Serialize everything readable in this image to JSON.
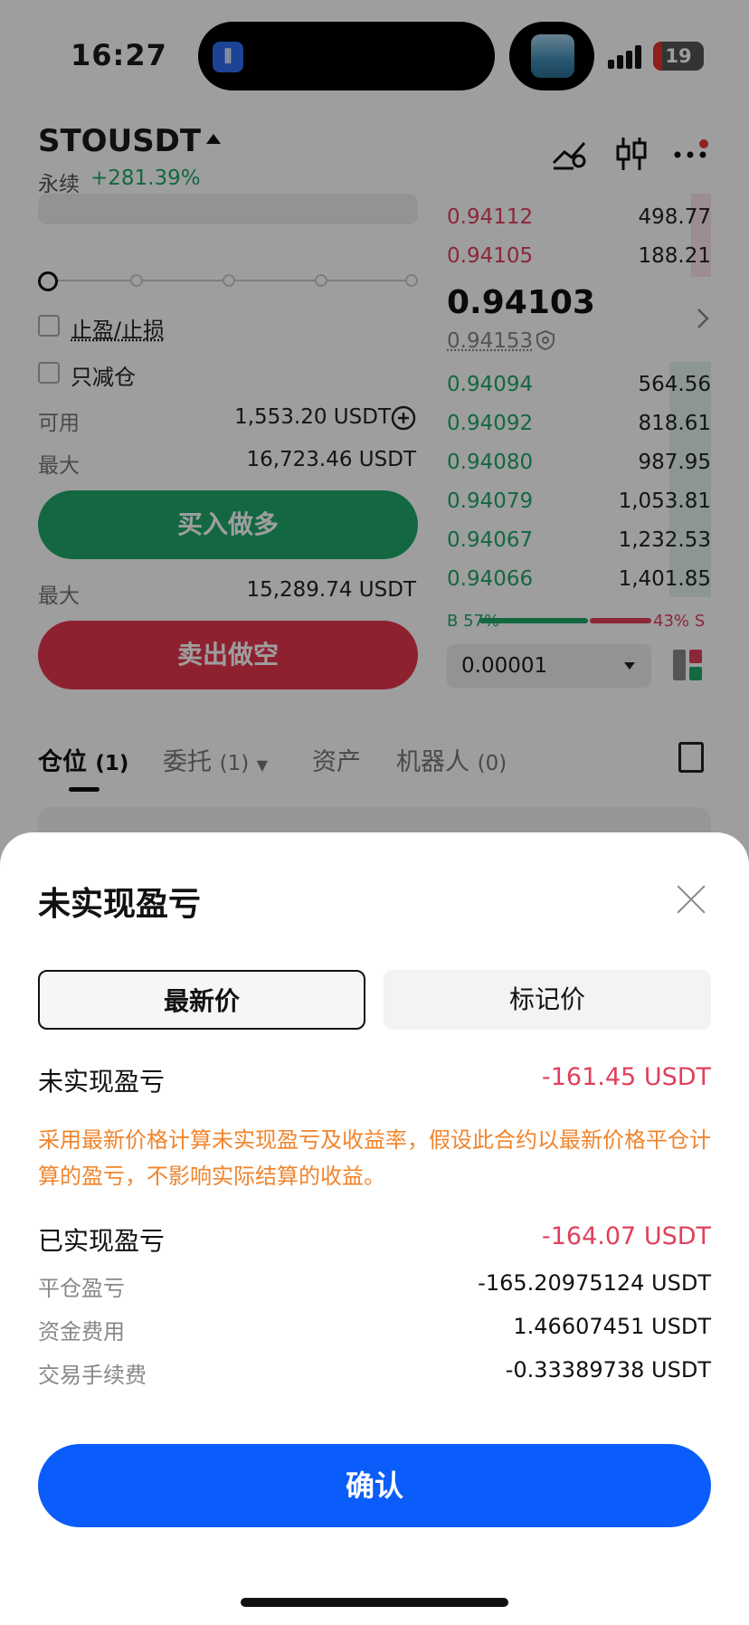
{
  "status_bar": {
    "time": "16:27",
    "battery": "19"
  },
  "header": {
    "symbol": "STOUSDT",
    "contract_type": "永续",
    "change_pct": "+281.39%"
  },
  "order_panel": {
    "take_profit_stop_loss": "止盈/止损",
    "reduce_only": "只减仓",
    "available_label": "可用",
    "available_value": "1,553.20 USDT",
    "max_label": "最大",
    "max_buy_value": "16,723.46 USDT",
    "buy_long": "买入做多",
    "max_sell_value": "15,289.74 USDT",
    "sell_short": "卖出做空"
  },
  "order_book": {
    "asks": [
      {
        "price": "0.94112",
        "qty": "498.77"
      },
      {
        "price": "0.94105",
        "qty": "188.21"
      }
    ],
    "last_price": "0.94103",
    "mark_price": "0.94153",
    "bids": [
      {
        "price": "0.94094",
        "qty": "564.56"
      },
      {
        "price": "0.94092",
        "qty": "818.61"
      },
      {
        "price": "0.94080",
        "qty": "987.95"
      },
      {
        "price": "0.94079",
        "qty": "1,053.81"
      },
      {
        "price": "0.94067",
        "qty": "1,232.53"
      },
      {
        "price": "0.94066",
        "qty": "1,401.85"
      }
    ],
    "buy_ratio": "B 57%",
    "sell_ratio": "43% S",
    "precision": "0.00001"
  },
  "tabs": [
    {
      "label": "仓位",
      "count": "(1)"
    },
    {
      "label": "委托",
      "count": "(1)"
    },
    {
      "label": "资产",
      "count": ""
    },
    {
      "label": "机器人",
      "count": "(0)"
    }
  ],
  "modal": {
    "title": "未实现盈亏",
    "segments": [
      "最新价",
      "标记价"
    ],
    "unrealized_label": "未实现盈亏",
    "unrealized_value": "-161.45 USDT",
    "note": "采用最新价格计算未实现盈亏及收益率，假设此合约以最新价格平仓计算的盈亏，不影响实际结算的收益。",
    "realized_label": "已实现盈亏",
    "realized_value": "-164.07 USDT",
    "details": [
      {
        "label": "平仓盈亏",
        "value": "-165.20975124 USDT"
      },
      {
        "label": "资金费用",
        "value": "1.46607451 USDT"
      },
      {
        "label": "交易手续费",
        "value": "-0.33389738 USDT"
      }
    ],
    "confirm": "确认"
  }
}
